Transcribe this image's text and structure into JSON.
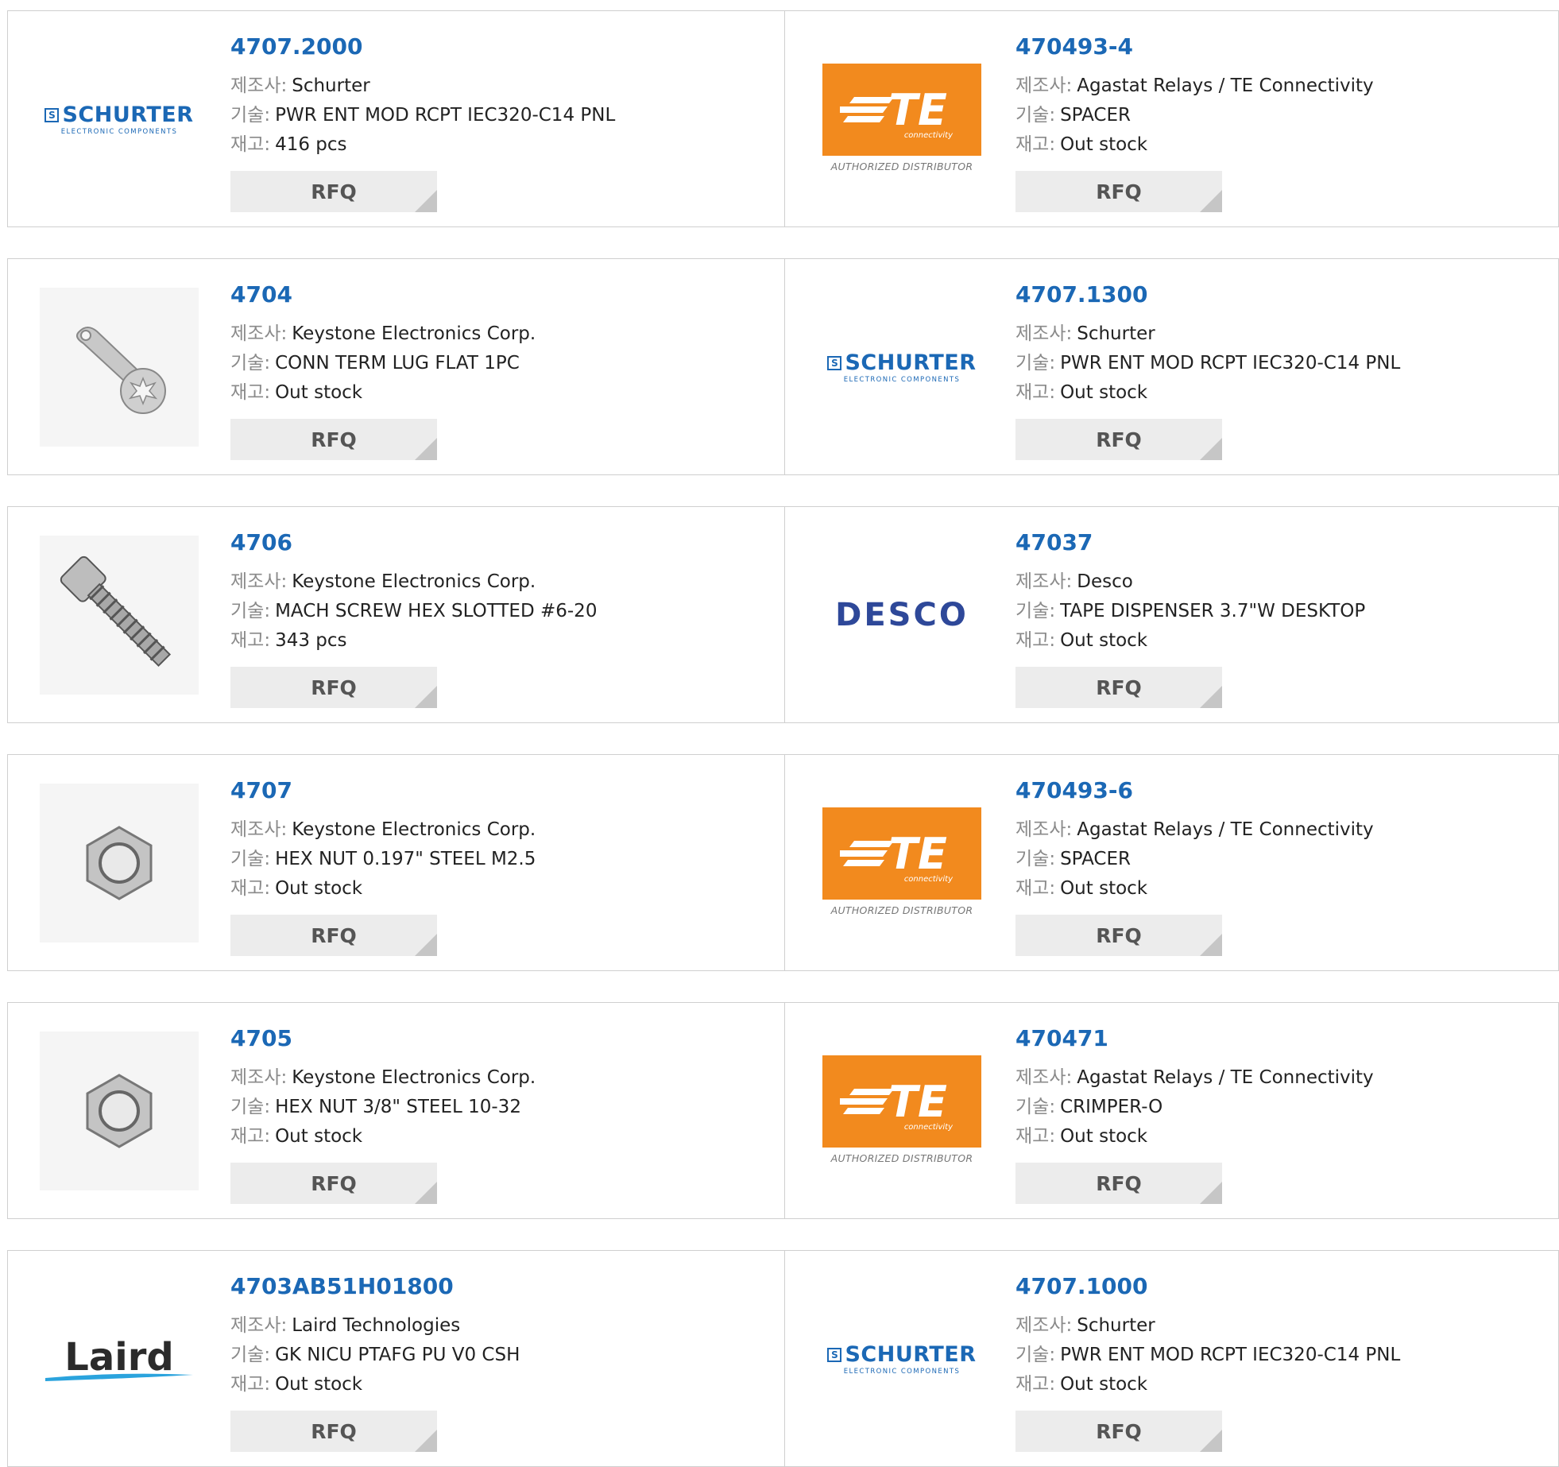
{
  "labels": {
    "manufacturer": "제조사:",
    "description": "기술:",
    "stock": "재고:",
    "rfq": "RFQ"
  },
  "colors": {
    "link": "#1b68b5",
    "te_orange": "#f28a1e",
    "desco": "#2e4899"
  },
  "brand_text": {
    "schurter_name": "SCHURTER",
    "schurter_sub": "ELECTRONIC COMPONENTS",
    "te_name": "TE",
    "te_sub": "connectivity",
    "te_authorized": "AUTHORIZED DISTRIBUTOR",
    "desco_name": "DESCO",
    "laird_name": "Laird"
  },
  "products": [
    {
      "part": "4707.2000",
      "manufacturer": "Schurter",
      "description": "PWR ENT MOD RCPT IEC320-C14 PNL",
      "stock": "416 pcs",
      "image": "schurter"
    },
    {
      "part": "470493-4",
      "manufacturer": "Agastat Relays / TE Connectivity",
      "description": "SPACER",
      "stock": "Out stock",
      "image": "te"
    },
    {
      "part": "4704",
      "manufacturer": "Keystone Electronics Corp.",
      "description": "CONN TERM LUG FLAT 1PC",
      "stock": "Out stock",
      "image": "lug"
    },
    {
      "part": "4707.1300",
      "manufacturer": "Schurter",
      "description": "PWR ENT MOD RCPT IEC320-C14 PNL",
      "stock": "Out stock",
      "image": "schurter"
    },
    {
      "part": "4706",
      "manufacturer": "Keystone Electronics Corp.",
      "description": "MACH SCREW HEX SLOTTED #6-20",
      "stock": "343 pcs",
      "image": "screw"
    },
    {
      "part": "47037",
      "manufacturer": "Desco",
      "description": "TAPE DISPENSER 3.7\"W DESKTOP",
      "stock": "Out stock",
      "image": "desco"
    },
    {
      "part": "4707",
      "manufacturer": "Keystone Electronics Corp.",
      "description": "HEX NUT 0.197\" STEEL M2.5",
      "stock": "Out stock",
      "image": "nut"
    },
    {
      "part": "470493-6",
      "manufacturer": "Agastat Relays / TE Connectivity",
      "description": "SPACER",
      "stock": "Out stock",
      "image": "te"
    },
    {
      "part": "4705",
      "manufacturer": "Keystone Electronics Corp.",
      "description": "HEX NUT 3/8\" STEEL 10-32",
      "stock": "Out stock",
      "image": "nut"
    },
    {
      "part": "470471",
      "manufacturer": "Agastat Relays / TE Connectivity",
      "description": "CRIMPER-O",
      "stock": "Out stock",
      "image": "te"
    },
    {
      "part": "4703AB51H01800",
      "manufacturer": "Laird Technologies",
      "description": "GK NICU PTAFG PU V0 CSH",
      "stock": "Out stock",
      "image": "laird"
    },
    {
      "part": "4707.1000",
      "manufacturer": "Schurter",
      "description": "PWR ENT MOD RCPT IEC320-C14 PNL",
      "stock": "Out stock",
      "image": "schurter"
    }
  ]
}
